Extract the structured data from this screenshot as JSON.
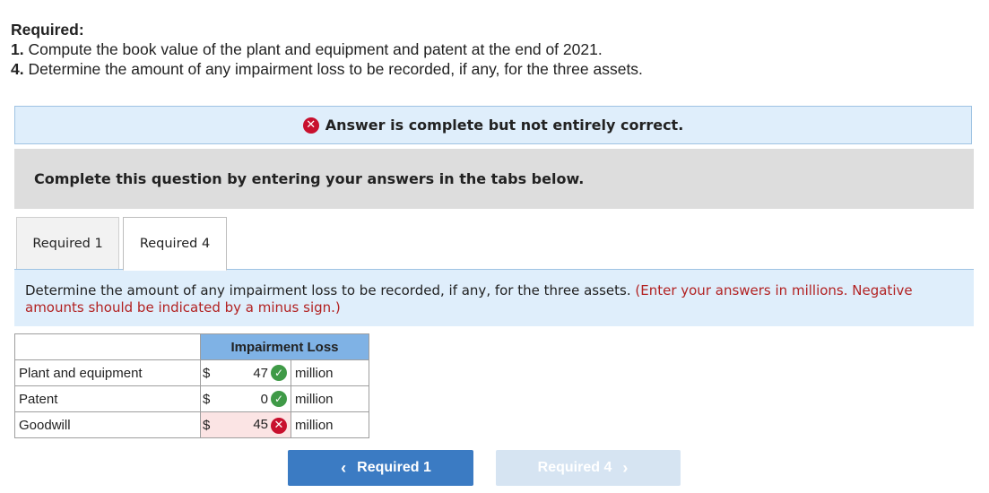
{
  "required": {
    "heading": "Required:",
    "items": [
      {
        "num": "1.",
        "text": "Compute the book value of the plant and equipment and patent at the end of 2021."
      },
      {
        "num": "4.",
        "text": "Determine the amount of any impairment loss to be recorded, if any, for the three assets."
      }
    ]
  },
  "banner": {
    "icon": "x-circle-icon",
    "text": "Answer is complete but not entirely correct."
  },
  "instruction": "Complete this question by entering your answers in the tabs below.",
  "tabs": [
    {
      "label": "Required 1",
      "active": false
    },
    {
      "label": "Required 4",
      "active": true
    }
  ],
  "question": {
    "text": "Determine the amount of any impairment loss to be recorded, if any, for the three assets.",
    "note": "(Enter your answers in millions. Negative amounts should be indicated by a minus sign.)"
  },
  "table": {
    "header": "Impairment Loss",
    "rows": [
      {
        "label": "Plant and equipment",
        "currency": "$",
        "value": "47",
        "status": "correct",
        "unit": "million"
      },
      {
        "label": "Patent",
        "currency": "$",
        "value": "0",
        "status": "correct",
        "unit": "million"
      },
      {
        "label": "Goodwill",
        "currency": "$",
        "value": "45",
        "status": "incorrect",
        "unit": "million"
      }
    ]
  },
  "nav": {
    "prev_label": "Required 1",
    "next_label": "Required 4"
  },
  "colors": {
    "correct": "#3f9a47",
    "incorrect": "#c8102e",
    "header": "#7fb2e5",
    "primary_button": "#3b7bc3"
  }
}
